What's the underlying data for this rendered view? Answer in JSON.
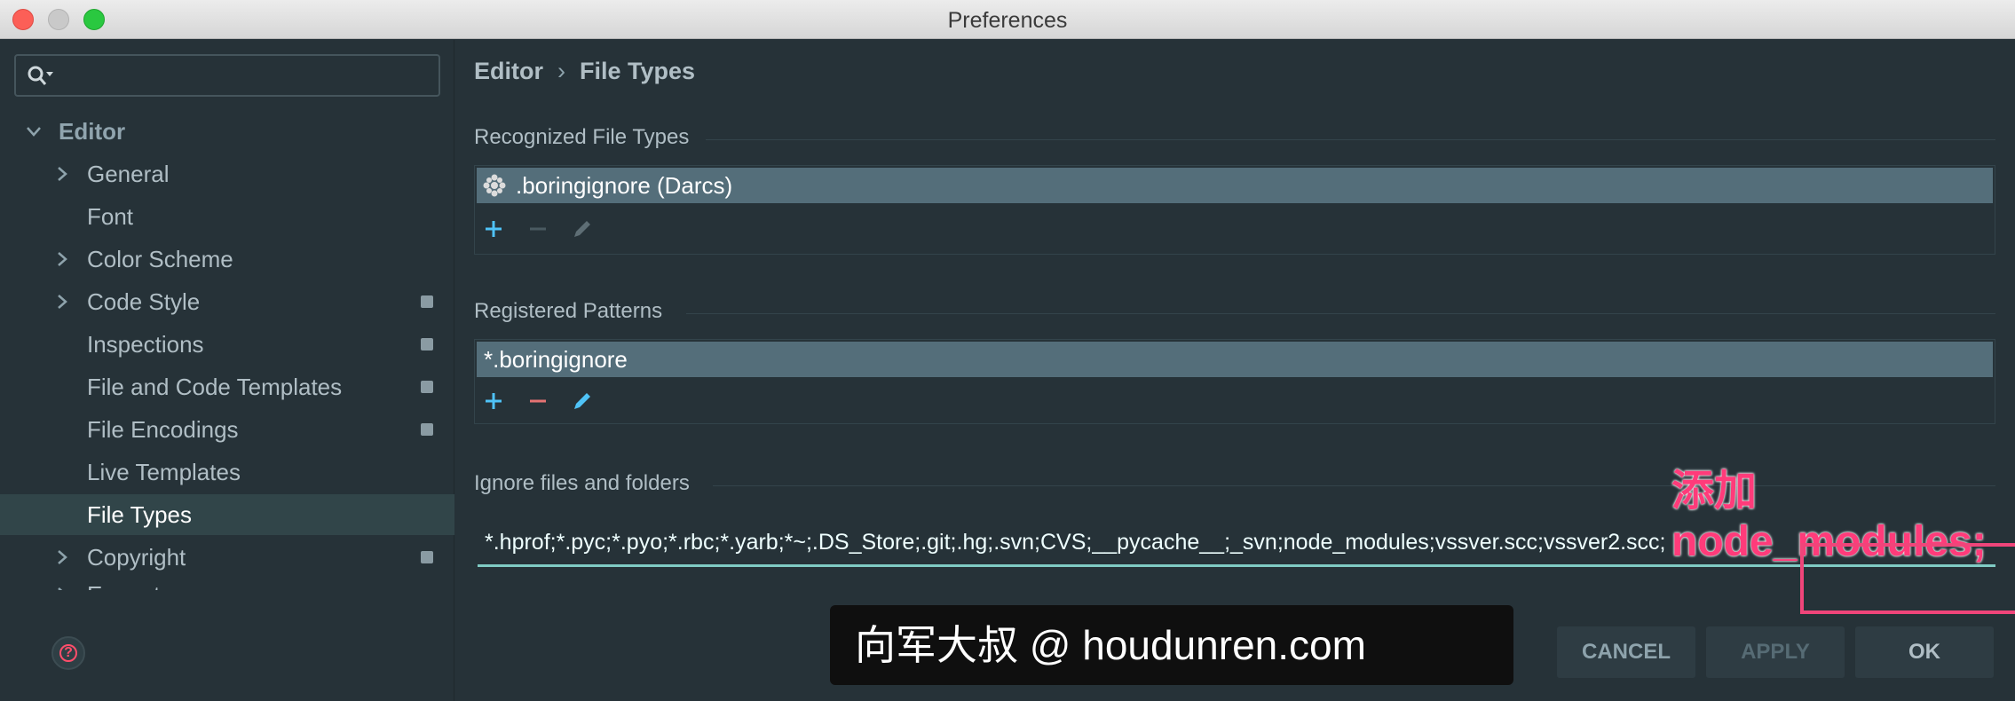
{
  "window": {
    "title": "Preferences"
  },
  "sidebar": {
    "search_placeholder": "",
    "items": [
      {
        "label": "Editor",
        "level": 0,
        "expanded": true
      },
      {
        "label": "General",
        "level": 1,
        "has_children": true
      },
      {
        "label": "Font",
        "level": 1
      },
      {
        "label": "Color Scheme",
        "level": 1,
        "has_children": true
      },
      {
        "label": "Code Style",
        "level": 1,
        "has_children": true,
        "project_badge": true
      },
      {
        "label": "Inspections",
        "level": 1,
        "project_badge": true
      },
      {
        "label": "File and Code Templates",
        "level": 1,
        "project_badge": true
      },
      {
        "label": "File Encodings",
        "level": 1,
        "project_badge": true
      },
      {
        "label": "Live Templates",
        "level": 1
      },
      {
        "label": "File Types",
        "level": 1,
        "selected": true
      },
      {
        "label": "Copyright",
        "level": 1,
        "has_children": true,
        "project_badge": true
      },
      {
        "label": "Emmet",
        "level": 1,
        "has_children": true
      }
    ]
  },
  "breadcrumb": {
    "parent": "Editor",
    "separator": "›",
    "current": "File Types"
  },
  "recognized": {
    "title": "Recognized File Types",
    "selected_item": ".boringignore (Darcs)"
  },
  "patterns": {
    "title": "Registered Patterns",
    "selected_item": "*.boringignore"
  },
  "ignore": {
    "title": "Ignore files and folders",
    "value": "*.hprof;*.pyc;*.pyo;*.rbc;*.yarb;*~;.DS_Store;.git;.hg;.svn;CVS;__pycache__;_svn;node_modules;vssver.scc;vssver2.scc;"
  },
  "annotation": {
    "text": "添加 node_modules;"
  },
  "watermark": {
    "text": "向军大叔 @ houdunren.com"
  },
  "buttons": {
    "cancel": "CANCEL",
    "apply": "APPLY",
    "ok": "OK"
  },
  "colors": {
    "accent": "#80cbc4",
    "add": "#4fc3f7",
    "remove": "#e57373",
    "annotation": "#ff3b7a"
  }
}
